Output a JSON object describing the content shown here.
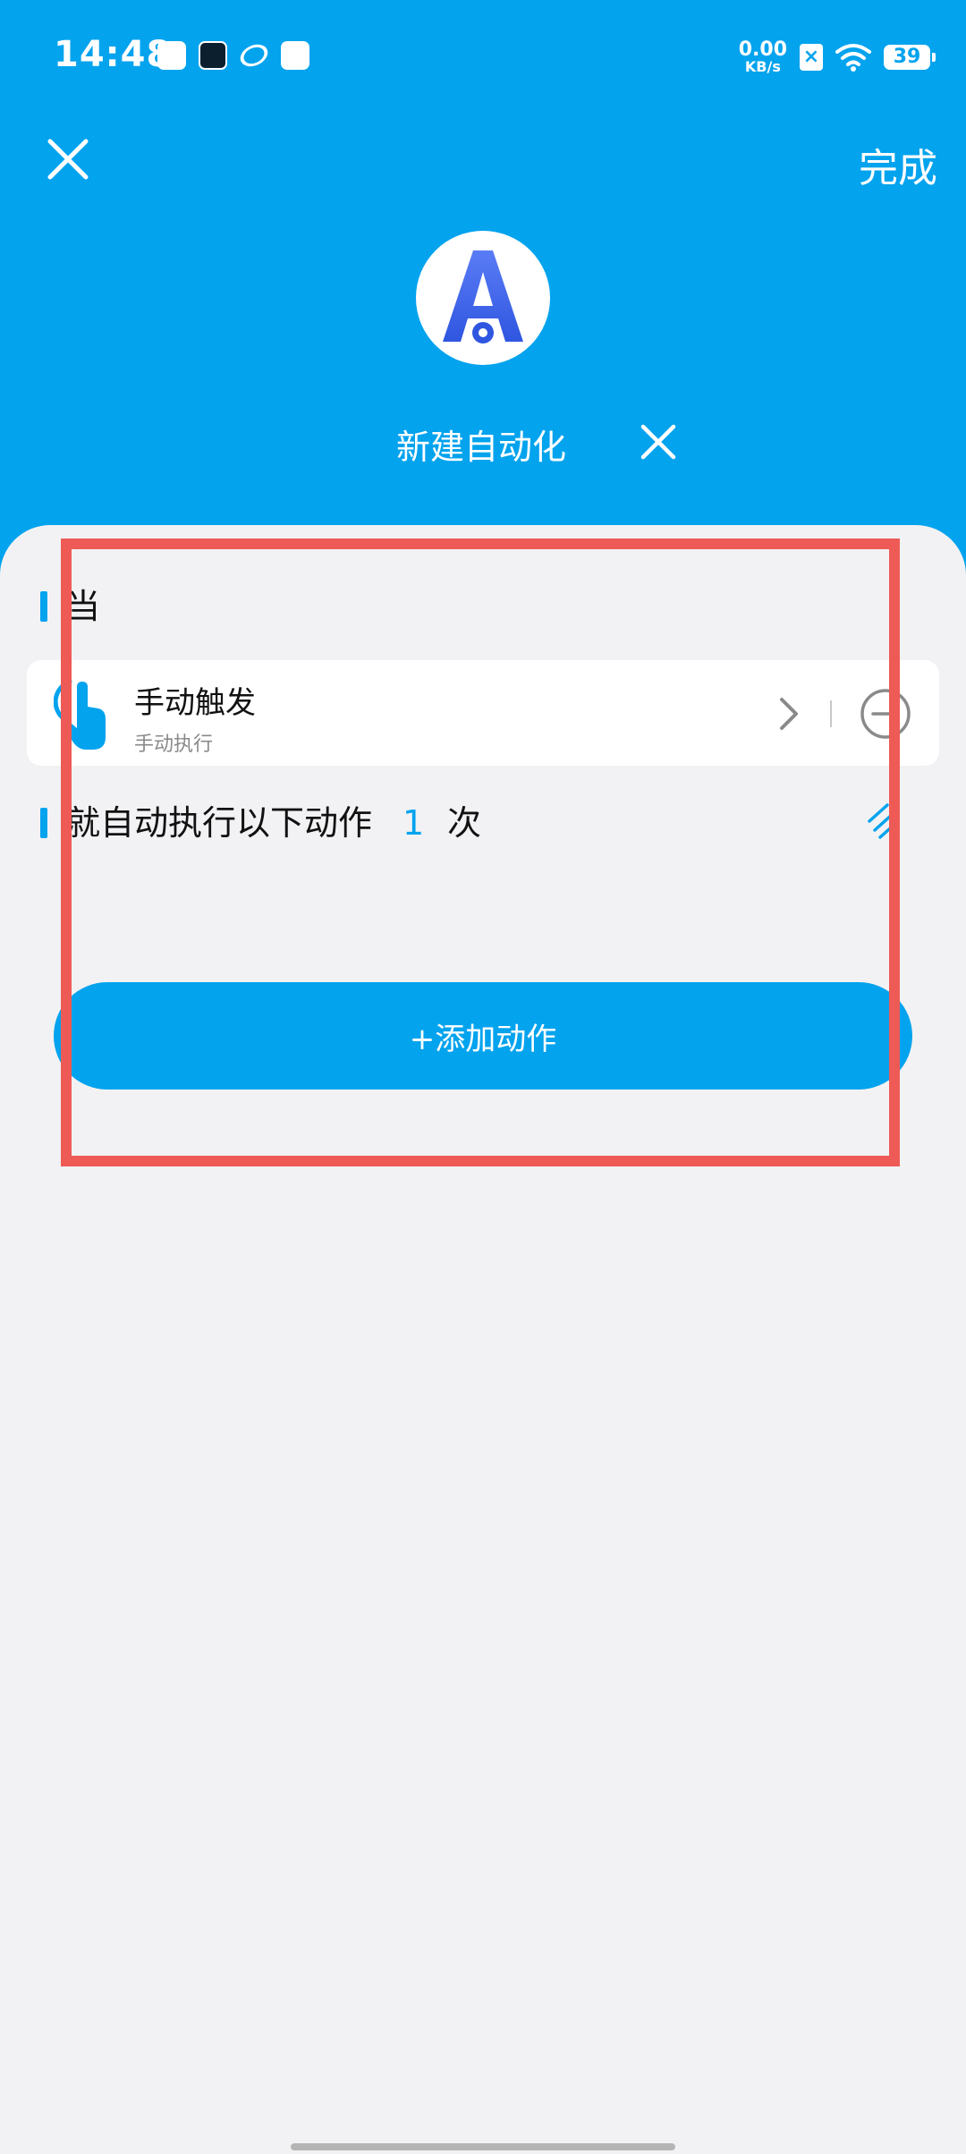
{
  "status_bar": {
    "time": "14:48",
    "net_speed_value": "0.00",
    "net_speed_unit": "KB/s",
    "battery": "39",
    "icons": [
      "notif-app-1-icon",
      "notif-app-2-icon",
      "notif-app-3-icon",
      "notif-app-4-icon",
      "sim-x-icon",
      "wifi-icon",
      "battery-icon"
    ]
  },
  "header": {
    "close_icon": "close-icon",
    "done_label": "完成",
    "app_icon": "automation-app-icon",
    "title": "新建自动化",
    "clear_icon": "close-icon"
  },
  "trigger_section": {
    "heading": "当",
    "trigger": {
      "title": "手动触发",
      "subtitle": "手动执行",
      "icon": "hand-tap-icon"
    }
  },
  "action_section": {
    "heading": "就自动执行以下动作",
    "repeat_count": "1",
    "repeat_unit": "次",
    "sort_icon": "collapse-icon"
  },
  "add_action_label": "+添加动作",
  "colors": {
    "primary": "#03a3ee",
    "background": "#f2f2f4",
    "highlight": "#ee5a55"
  }
}
